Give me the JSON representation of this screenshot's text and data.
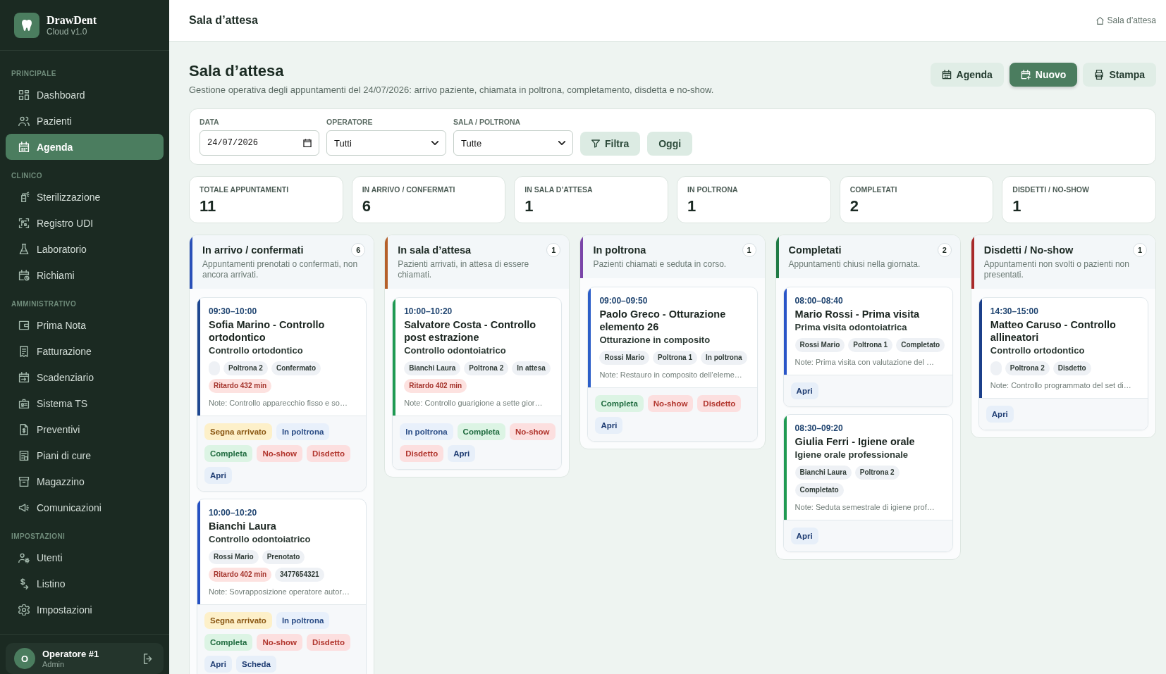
{
  "sidebar": {
    "brand": {
      "name": "DrawDent",
      "version": "Cloud v1.0"
    },
    "sections": [
      {
        "title": "PRINCIPALE",
        "items": [
          {
            "label": "Dashboard",
            "selected": false
          },
          {
            "label": "Pazienti",
            "selected": false
          },
          {
            "label": "Agenda",
            "selected": true
          }
        ]
      },
      {
        "title": "CLINICO",
        "items": [
          {
            "label": "Sterilizzazione",
            "selected": false
          },
          {
            "label": "Registro UDI",
            "selected": false
          },
          {
            "label": "Laboratorio",
            "selected": false
          },
          {
            "label": "Richiami",
            "selected": false
          }
        ]
      },
      {
        "title": "AMMINISTRATIVO",
        "items": [
          {
            "label": "Prima Nota",
            "selected": false
          },
          {
            "label": "Fatturazione",
            "selected": false
          },
          {
            "label": "Scadenziario",
            "selected": false
          },
          {
            "label": "Sistema TS",
            "selected": false
          },
          {
            "label": "Preventivi",
            "selected": false
          },
          {
            "label": "Piani di cure",
            "selected": false
          },
          {
            "label": "Magazzino",
            "selected": false
          },
          {
            "label": "Comunicazioni",
            "selected": false
          }
        ]
      },
      {
        "title": "IMPOSTAZIONI",
        "items": [
          {
            "label": "Utenti",
            "selected": false
          },
          {
            "label": "Listino",
            "selected": false
          },
          {
            "label": "Impostazioni",
            "selected": false
          }
        ]
      }
    ],
    "user": {
      "initial": "O",
      "name": "Operatore #1",
      "role": "Admin"
    }
  },
  "top_bar": {
    "title": "Sala d’attesa",
    "breadcrumb": "Sala d’attesa"
  },
  "page": {
    "title": "Sala d’attesa",
    "subtitle": "Gestione operativa degli appuntamenti del 24/07/2026: arrivo paziente, chiamata in poltrona, completamento, disdetta e no-show.",
    "actions": [
      {
        "label": "Agenda",
        "primary": false
      },
      {
        "label": "Nuovo",
        "primary": true
      },
      {
        "label": "Stampa",
        "primary": false
      }
    ]
  },
  "filters": {
    "fields": [
      {
        "label": "DATA",
        "kind": "date",
        "value": "24/07/2026"
      },
      {
        "label": "OPERATORE",
        "kind": "select",
        "value": "Tutti"
      },
      {
        "label": "SALA / POLTRONA",
        "kind": "select",
        "value": "Tutte"
      }
    ],
    "buttons": [
      {
        "label": "Filtra",
        "kind": "filter"
      },
      {
        "label": "Oggi",
        "kind": "plain"
      }
    ]
  },
  "stats": [
    {
      "label": "TOTALE APPUNTAMENTI",
      "value": "11"
    },
    {
      "label": "IN ARRIVO / CONFERMATI",
      "value": "6"
    },
    {
      "label": "IN SALA D’ATTESA",
      "value": "1"
    },
    {
      "label": "IN POLTRONA",
      "value": "1"
    },
    {
      "label": "COMPLETATI",
      "value": "2"
    },
    {
      "label": "DISDETTI / NO-SHOW",
      "value": "1"
    }
  ],
  "columns": [
    {
      "title": "In arrivo / confermati",
      "count": "6",
      "color": "#2a50b8",
      "description": "Appuntamenti prenotati o confermati, non ancora arrivati.",
      "appointments": [
        {
          "time": "09:30–10:00",
          "title": "Sofia Marino - Controllo ortodontico",
          "treatment": "Controllo ortodontico",
          "color": "#1d4690",
          "tags": [
            {
              "kind": "blank"
            },
            {
              "kind": "plain",
              "label": "Poltrona 2"
            },
            {
              "kind": "plain",
              "label": "Confermato"
            },
            {
              "kind": "delay",
              "label": "Ritardo 432 min"
            }
          ],
          "note": "Note: Controllo apparecchio fisso e so…",
          "actions": [
            {
              "kind": "arrive",
              "label": "Segna arrivato"
            },
            {
              "kind": "chair",
              "label": "In poltrona"
            },
            {
              "kind": "complete",
              "label": "Completa"
            },
            {
              "kind": "noshow",
              "label": "No-show"
            },
            {
              "kind": "cancel",
              "label": "Disdetto"
            },
            {
              "kind": "open",
              "label": "Apri"
            }
          ]
        },
        {
          "time": "10:00–10:20",
          "title": "Bianchi Laura",
          "treatment": "Controllo odontoiatrico",
          "color": "#2450c2",
          "tags": [
            {
              "kind": "plain",
              "label": "Rossi Mario"
            },
            {
              "kind": "plain",
              "label": "Prenotato"
            },
            {
              "kind": "delay",
              "label": "Ritardo 402 min"
            },
            {
              "kind": "plain",
              "label": "3477654321"
            }
          ],
          "note": "Note: Sovrapposizione operatore autor…",
          "actions": [
            {
              "kind": "arrive",
              "label": "Segna arrivato"
            },
            {
              "kind": "chair",
              "label": "In poltrona"
            },
            {
              "kind": "complete",
              "label": "Completa"
            },
            {
              "kind": "noshow",
              "label": "No-show"
            },
            {
              "kind": "cancel",
              "label": "Disdetto"
            },
            {
              "kind": "open",
              "label": "Apri"
            },
            {
              "kind": "sheet",
              "label": "Scheda"
            }
          ]
        }
      ]
    },
    {
      "title": "In sala d’attesa",
      "count": "1",
      "color": "#b5602a",
      "description": "Pazienti arrivati, in attesa di essere chiamati.",
      "appointments": [
        {
          "time": "10:00–10:20",
          "title": "Salvatore Costa - Controllo post estrazione",
          "treatment": "Controllo odontoiatrico",
          "color": "#1f9a52",
          "tags": [
            {
              "kind": "plain",
              "label": "Bianchi Laura"
            },
            {
              "kind": "plain",
              "label": "Poltrona 2"
            },
            {
              "kind": "plain",
              "label": "In attesa"
            },
            {
              "kind": "delay",
              "label": "Ritardo 402 min"
            }
          ],
          "note": "Note: Controllo guarigione a sette gior…",
          "actions": [
            {
              "kind": "chair",
              "label": "In poltrona"
            },
            {
              "kind": "complete",
              "label": "Completa"
            },
            {
              "kind": "noshow",
              "label": "No-show"
            },
            {
              "kind": "cancel",
              "label": "Disdetto"
            },
            {
              "kind": "open",
              "label": "Apri"
            }
          ]
        }
      ]
    },
    {
      "title": "In poltrona",
      "count": "1",
      "color": "#7a45a8",
      "description": "Pazienti chiamati e seduta in corso.",
      "appointments": [
        {
          "time": "09:00–09:50",
          "title": "Paolo Greco - Otturazione elemento 26",
          "treatment": "Otturazione in composito",
          "color": "#2c5ec8",
          "tags": [
            {
              "kind": "plain",
              "label": "Rossi Mario"
            },
            {
              "kind": "plain",
              "label": "Poltrona 1"
            },
            {
              "kind": "plain",
              "label": "In poltrona"
            }
          ],
          "note": "Note: Restauro in composito dell’eleme…",
          "actions": [
            {
              "kind": "complete",
              "label": "Completa"
            },
            {
              "kind": "noshow",
              "label": "No-show"
            },
            {
              "kind": "cancel",
              "label": "Disdetto"
            },
            {
              "kind": "open",
              "label": "Apri"
            }
          ]
        }
      ]
    },
    {
      "title": "Completati",
      "count": "2",
      "color": "#1f7a44",
      "description": "Appuntamenti chiusi nella giornata.",
      "appointments": [
        {
          "time": "08:00–08:40",
          "title": "Mario Rossi - Prima visita",
          "treatment": "Prima visita odontoiatrica",
          "color": "#2a55c8",
          "tags": [
            {
              "kind": "plain",
              "label": "Rossi Mario"
            },
            {
              "kind": "plain",
              "label": "Poltrona 1"
            },
            {
              "kind": "plain",
              "label": "Completato"
            }
          ],
          "note": "Note: Prima visita con valutazione del …",
          "actions": [
            {
              "kind": "open",
              "label": "Apri"
            }
          ]
        },
        {
          "time": "08:30–09:20",
          "title": "Giulia Ferri - Igiene orale",
          "treatment": "Igiene orale professionale",
          "color": "#1f9a52",
          "tags": [
            {
              "kind": "plain",
              "label": "Bianchi Laura"
            },
            {
              "kind": "plain",
              "label": "Poltrona 2"
            },
            {
              "kind": "plain",
              "label": "Completato"
            }
          ],
          "note": "Note: Seduta semestrale di igiene prof…",
          "actions": [
            {
              "kind": "open",
              "label": "Apri"
            }
          ]
        }
      ]
    },
    {
      "title": "Disdetti / No-show",
      "count": "1",
      "color": "#a82a2a",
      "description": "Appuntamenti non svolti o pazienti non presentati.",
      "appointments": [
        {
          "time": "14:30–15:00",
          "title": "Matteo Caruso - Controllo allineatori",
          "treatment": "Controllo ortodontico",
          "color": "#1b3f8a",
          "tags": [
            {
              "kind": "blank"
            },
            {
              "kind": "plain",
              "label": "Poltrona 2"
            },
            {
              "kind": "plain",
              "label": "Disdetto"
            }
          ],
          "note": "Note: Controllo programmato del set di…",
          "actions": [
            {
              "kind": "open",
              "label": "Apri"
            }
          ]
        }
      ]
    }
  ]
}
